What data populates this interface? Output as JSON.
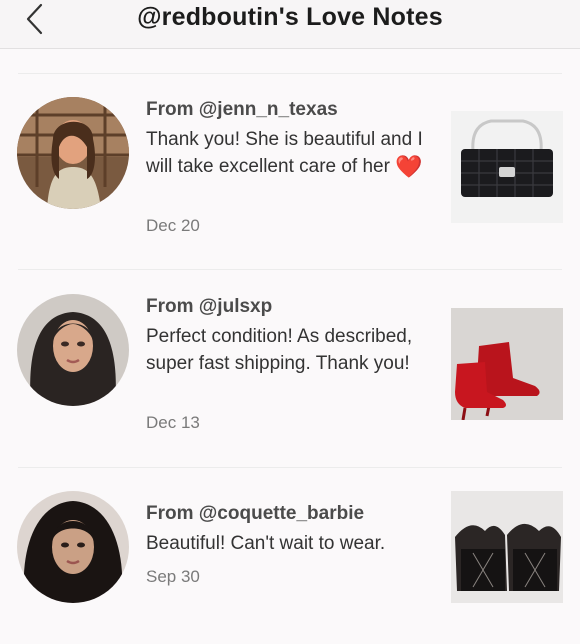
{
  "header": {
    "title": "@redboutin's Love Notes"
  },
  "notes": [
    {
      "from": "From @jenn_n_texas",
      "message": "Thank you! She is beautiful and I will take excellent care of her",
      "emoji": "❤️",
      "date": "Dec 20",
      "product": "black quilted chain bag"
    },
    {
      "from": "From @julsxp",
      "message": "Perfect condition! As described, super fast shipping. Thank you!",
      "date": "Dec 13",
      "product": "red suede booties"
    },
    {
      "from": "From @coquette_barbie",
      "message": "Beautiful! Can't wait to wear.",
      "date": "Sep 30",
      "product": "black fur-trim booties"
    }
  ],
  "colors": {
    "header_bg": "#f7f5f6",
    "page_bg": "#fbf9fa",
    "heart": "#e0212b"
  }
}
